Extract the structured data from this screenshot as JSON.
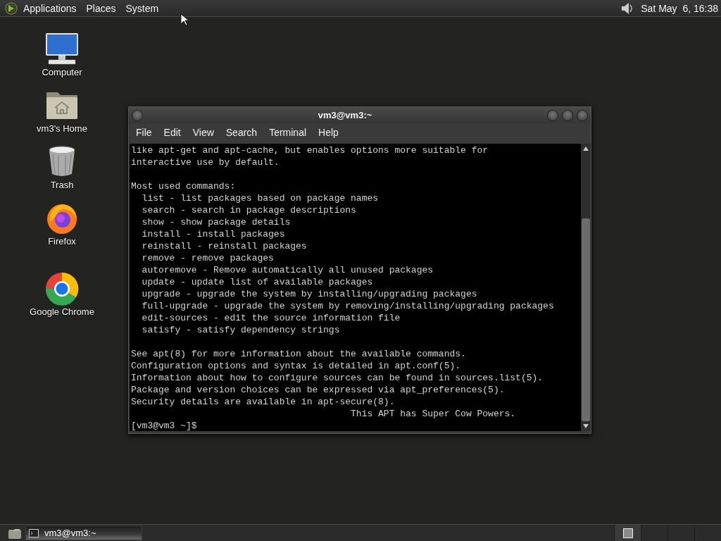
{
  "top_panel": {
    "menus": [
      "Applications",
      "Places",
      "System"
    ],
    "clock": "Sat May  6, 16:38"
  },
  "desktop_icons": [
    {
      "label": "Computer",
      "kind": "computer"
    },
    {
      "label": "vm3's Home",
      "kind": "home"
    },
    {
      "label": "Trash",
      "kind": "trash"
    },
    {
      "label": "Firefox",
      "kind": "firefox"
    },
    {
      "label": "Google Chrome",
      "kind": "chrome"
    }
  ],
  "terminal": {
    "title": "vm3@vm3:~",
    "menus": [
      "File",
      "Edit",
      "View",
      "Search",
      "Terminal",
      "Help"
    ],
    "blocks": [
      [
        "like apt-get and apt-cache, but enables options more suitable for",
        "interactive use by default."
      ],
      [
        "Most used commands:",
        "  list - list packages based on package names",
        "  search - search in package descriptions",
        "  show - show package details",
        "  install - install packages",
        "  reinstall - reinstall packages",
        "  remove - remove packages",
        "  autoremove - Remove automatically all unused packages",
        "  update - update list of available packages",
        "  upgrade - upgrade the system by installing/upgrading packages",
        "  full-upgrade - upgrade the system by removing/installing/upgrading packages",
        "  edit-sources - edit the source information file",
        "  satisfy - satisfy dependency strings"
      ],
      [
        "See apt(8) for more information about the available commands.",
        "Configuration options and syntax is detailed in apt.conf(5).",
        "Information about how to configure sources can be found in sources.list(5).",
        "Package and version choices can be expressed via apt_preferences(5).",
        "Security details are available in apt-secure(8).",
        "                                        This APT has Super Cow Powers.",
        "[vm3@vm3 ~]$"
      ]
    ]
  },
  "taskbar": {
    "tasks": [
      {
        "label": "vm3@vm3:~",
        "selected": true
      }
    ],
    "workspaces": [
      {
        "selected": true
      },
      {
        "selected": false
      },
      {
        "selected": false
      },
      {
        "selected": false
      }
    ]
  }
}
